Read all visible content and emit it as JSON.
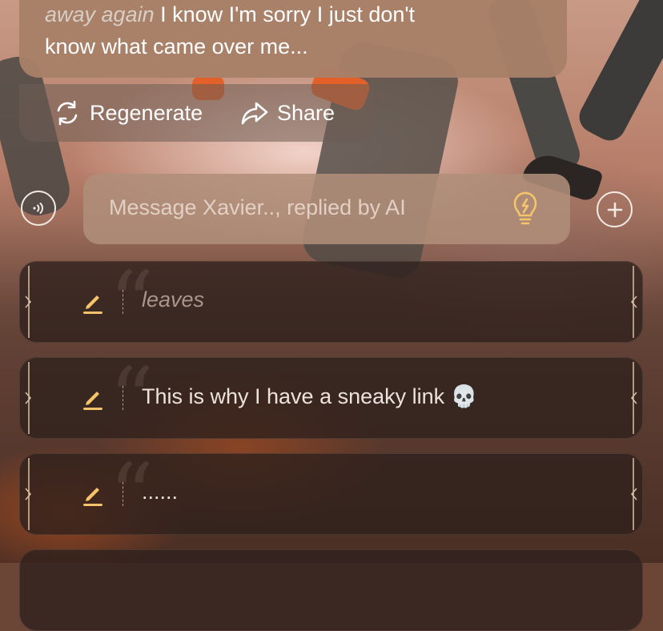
{
  "message": {
    "italic_prefix": "away again",
    "line1_rest": " I know I'm sorry I just don't",
    "line2": "know what came over me..."
  },
  "actions": {
    "regenerate_label": "Regenerate",
    "share_label": "Share"
  },
  "composer": {
    "placeholder": "Message Xavier.., replied by AI"
  },
  "suggestions": [
    {
      "text": "leaves",
      "style": "italic"
    },
    {
      "text": "This is why I have a sneaky link 💀",
      "style": "normal"
    },
    {
      "text": "......",
      "style": "normal"
    }
  ],
  "colors": {
    "accent": "#f5c46a",
    "icon_light": "#f2e9e2"
  },
  "icons": {
    "regenerate": "refresh-icon",
    "share": "share-arrow-icon",
    "voice": "voice-waves-icon",
    "hint": "lightbulb-icon",
    "add": "plus-icon",
    "edit": "pencil-icon"
  }
}
